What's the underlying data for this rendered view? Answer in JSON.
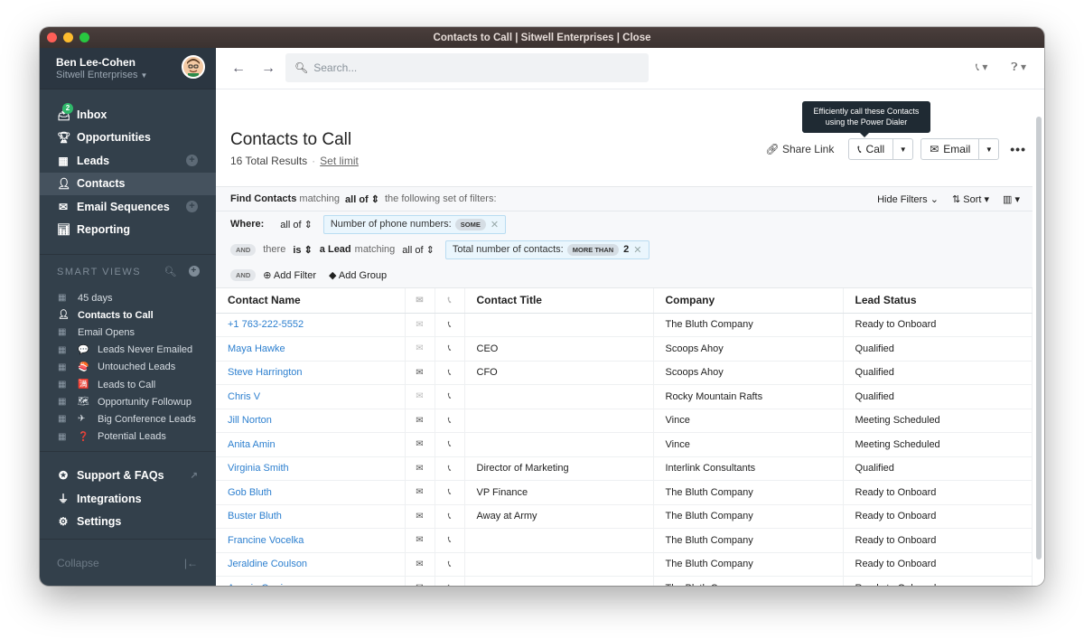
{
  "window": {
    "title": "Contacts to Call | Sitwell Enterprises | Close",
    "traffic_colors": [
      "#fe5f57",
      "#febc2e",
      "#28c840"
    ]
  },
  "user": {
    "name": "Ben Lee-Cohen",
    "org": "Sitwell Enterprises"
  },
  "nav": [
    {
      "label": "Inbox",
      "icon": "inbox-icon",
      "badge": "2"
    },
    {
      "label": "Opportunities",
      "icon": "trophy-icon"
    },
    {
      "label": "Leads",
      "icon": "building-icon",
      "plus": true
    },
    {
      "label": "Contacts",
      "icon": "person-icon",
      "active": true
    },
    {
      "label": "Email Sequences",
      "icon": "sequence-icon",
      "plus": true
    },
    {
      "label": "Reporting",
      "icon": "chart-icon"
    }
  ],
  "smart_views": {
    "header": "SMART VIEWS",
    "items": [
      {
        "label": "45 days",
        "icon": "building-icon"
      },
      {
        "label": "Contacts to Call",
        "icon": "person-icon",
        "active": true
      },
      {
        "label": "Email Opens",
        "icon": "building-icon"
      },
      {
        "label": "Leads Never Emailed",
        "icon": "building-icon",
        "emoji": "💬"
      },
      {
        "label": "Untouched Leads",
        "icon": "building-icon",
        "emoji": "🍣"
      },
      {
        "label": "Leads to Call",
        "icon": "building-icon",
        "emoji": "🈵"
      },
      {
        "label": "Opportunity Followup",
        "icon": "building-icon",
        "emoji": "🗺"
      },
      {
        "label": "Big Conference Leads",
        "icon": "building-icon",
        "emoji": "✈"
      },
      {
        "label": "Potential Leads",
        "icon": "building-icon",
        "emoji": "❓"
      }
    ]
  },
  "nav2": [
    {
      "label": "Support & FAQs",
      "icon": "support-icon"
    },
    {
      "label": "Integrations",
      "icon": "plug-icon"
    },
    {
      "label": "Settings",
      "icon": "gear-icon"
    }
  ],
  "collapse_label": "Collapse",
  "search": {
    "placeholder": "Search..."
  },
  "tooltip": {
    "line1": "Efficiently call these Contacts",
    "line2": "using the Power Dialer"
  },
  "page": {
    "title": "Contacts to Call",
    "total": "16 Total Results",
    "set_limit": "Set limit",
    "share_link": "Share Link",
    "call": "Call",
    "email": "Email"
  },
  "filters": {
    "find": "Find Contacts",
    "matching": "matching",
    "all_of": "all of",
    "following": "the following set of filters:",
    "hide_filters": "Hide Filters",
    "sort": "Sort",
    "where": "Where:",
    "pill1_label": "Number of phone numbers:",
    "pill1_tag": "SOME",
    "and": "AND",
    "there": "there",
    "is": "is",
    "a_lead": "a Lead",
    "pill2_label": "Total number of contacts:",
    "pill2_tag": "MORE THAN",
    "pill2_value": "2",
    "add_filter": "Add Filter",
    "add_group": "Add Group"
  },
  "table": {
    "columns": [
      "Contact Name",
      "Contact Title",
      "Company",
      "Lead Status"
    ],
    "rows": [
      {
        "name": "+1 763-222-5552",
        "mail": false,
        "title": "",
        "company": "The Bluth Company",
        "status": "Ready to Onboard"
      },
      {
        "name": "Maya Hawke",
        "mail": false,
        "title": "CEO",
        "company": "Scoops Ahoy",
        "status": "Qualified"
      },
      {
        "name": "Steve Harrington",
        "mail": true,
        "title": "CFO",
        "company": "Scoops Ahoy",
        "status": "Qualified"
      },
      {
        "name": "Chris V",
        "mail": false,
        "title": "",
        "company": "Rocky Mountain Rafts",
        "status": "Qualified"
      },
      {
        "name": "Jill Norton",
        "mail": true,
        "title": "",
        "company": "Vince",
        "status": "Meeting Scheduled"
      },
      {
        "name": "Anita Amin",
        "mail": true,
        "title": "",
        "company": "Vince",
        "status": "Meeting Scheduled"
      },
      {
        "name": "Virginia Smith",
        "mail": true,
        "title": "Director of Marketing",
        "company": "Interlink Consultants",
        "status": "Qualified"
      },
      {
        "name": "Gob Bluth",
        "mail": true,
        "title": "VP Finance",
        "company": "The Bluth Company",
        "status": "Ready to Onboard"
      },
      {
        "name": "Buster Bluth",
        "mail": true,
        "title": "Away at Army",
        "company": "The Bluth Company",
        "status": "Ready to Onboard"
      },
      {
        "name": "Francine Vocelka",
        "mail": true,
        "title": "",
        "company": "The Bluth Company",
        "status": "Ready to Onboard"
      },
      {
        "name": "Jeraldine Coulson",
        "mail": true,
        "title": "",
        "company": "The Bluth Company",
        "status": "Ready to Onboard"
      },
      {
        "name": "Ammie Corrio",
        "mail": true,
        "title": "",
        "company": "The Bluth Company",
        "status": "Ready to Onboard"
      }
    ]
  }
}
